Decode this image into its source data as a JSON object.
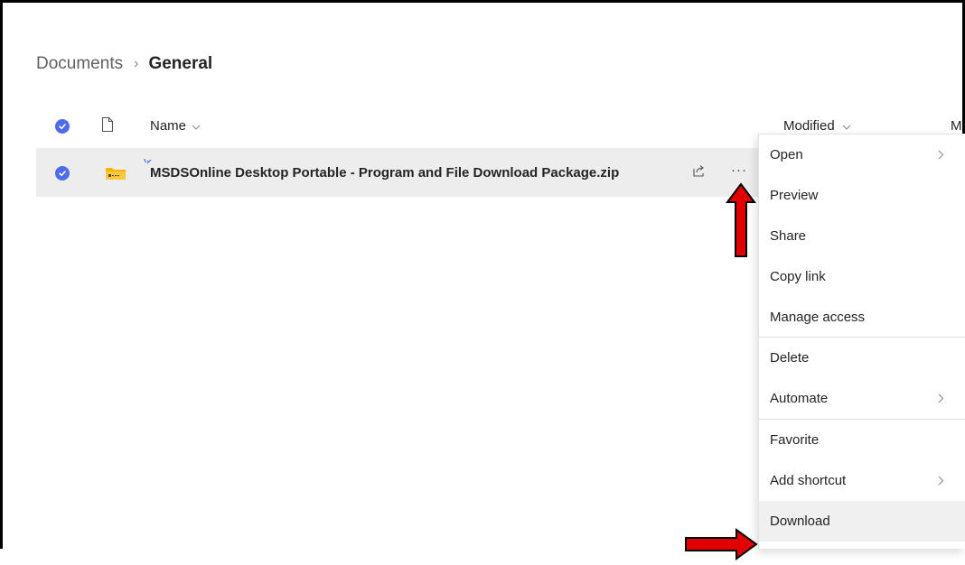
{
  "breadcrumb": {
    "parent": "Documents",
    "separator": "›",
    "current": "General"
  },
  "columns": {
    "name_label": "Name",
    "modified_label": "Modified",
    "extra_label": "M"
  },
  "file_row": {
    "file_name": "MSDSOnline Desktop Portable - Program and File Download Package.zip",
    "more_glyph": "···",
    "extra_glyph": ":",
    "selected": true,
    "file_type_icon": "zip-folder-icon"
  },
  "context_menu": {
    "items": [
      {
        "label": "Open",
        "has_submenu": true
      },
      {
        "label": "Preview",
        "has_submenu": false
      },
      {
        "label": "Share",
        "has_submenu": false
      },
      {
        "label": "Copy link",
        "has_submenu": false
      },
      {
        "label": "Manage access",
        "has_submenu": false
      },
      {
        "label": "Delete",
        "has_submenu": false
      },
      {
        "label": "Automate",
        "has_submenu": true
      },
      {
        "label": "Favorite",
        "has_submenu": false
      },
      {
        "label": "Add shortcut",
        "has_submenu": true
      },
      {
        "label": "Download",
        "has_submenu": false,
        "highlighted": true
      }
    ]
  },
  "colors": {
    "accent": "#4f6bed",
    "row_selected_bg": "#ededed",
    "menu_hover_bg": "#f0f0f0",
    "annotation_arrow": "#e00000",
    "folder_yellow": "#f4b400"
  },
  "icons": {
    "select_all": "checkmark-circle-icon",
    "file_type_header": "document-icon",
    "new_indicator": "sparkle-icon",
    "share": "share-icon",
    "submenu": "chevron-right-icon",
    "sort": "chevron-down-icon"
  },
  "annotations": [
    "red-arrow-up",
    "red-arrow-right"
  ]
}
